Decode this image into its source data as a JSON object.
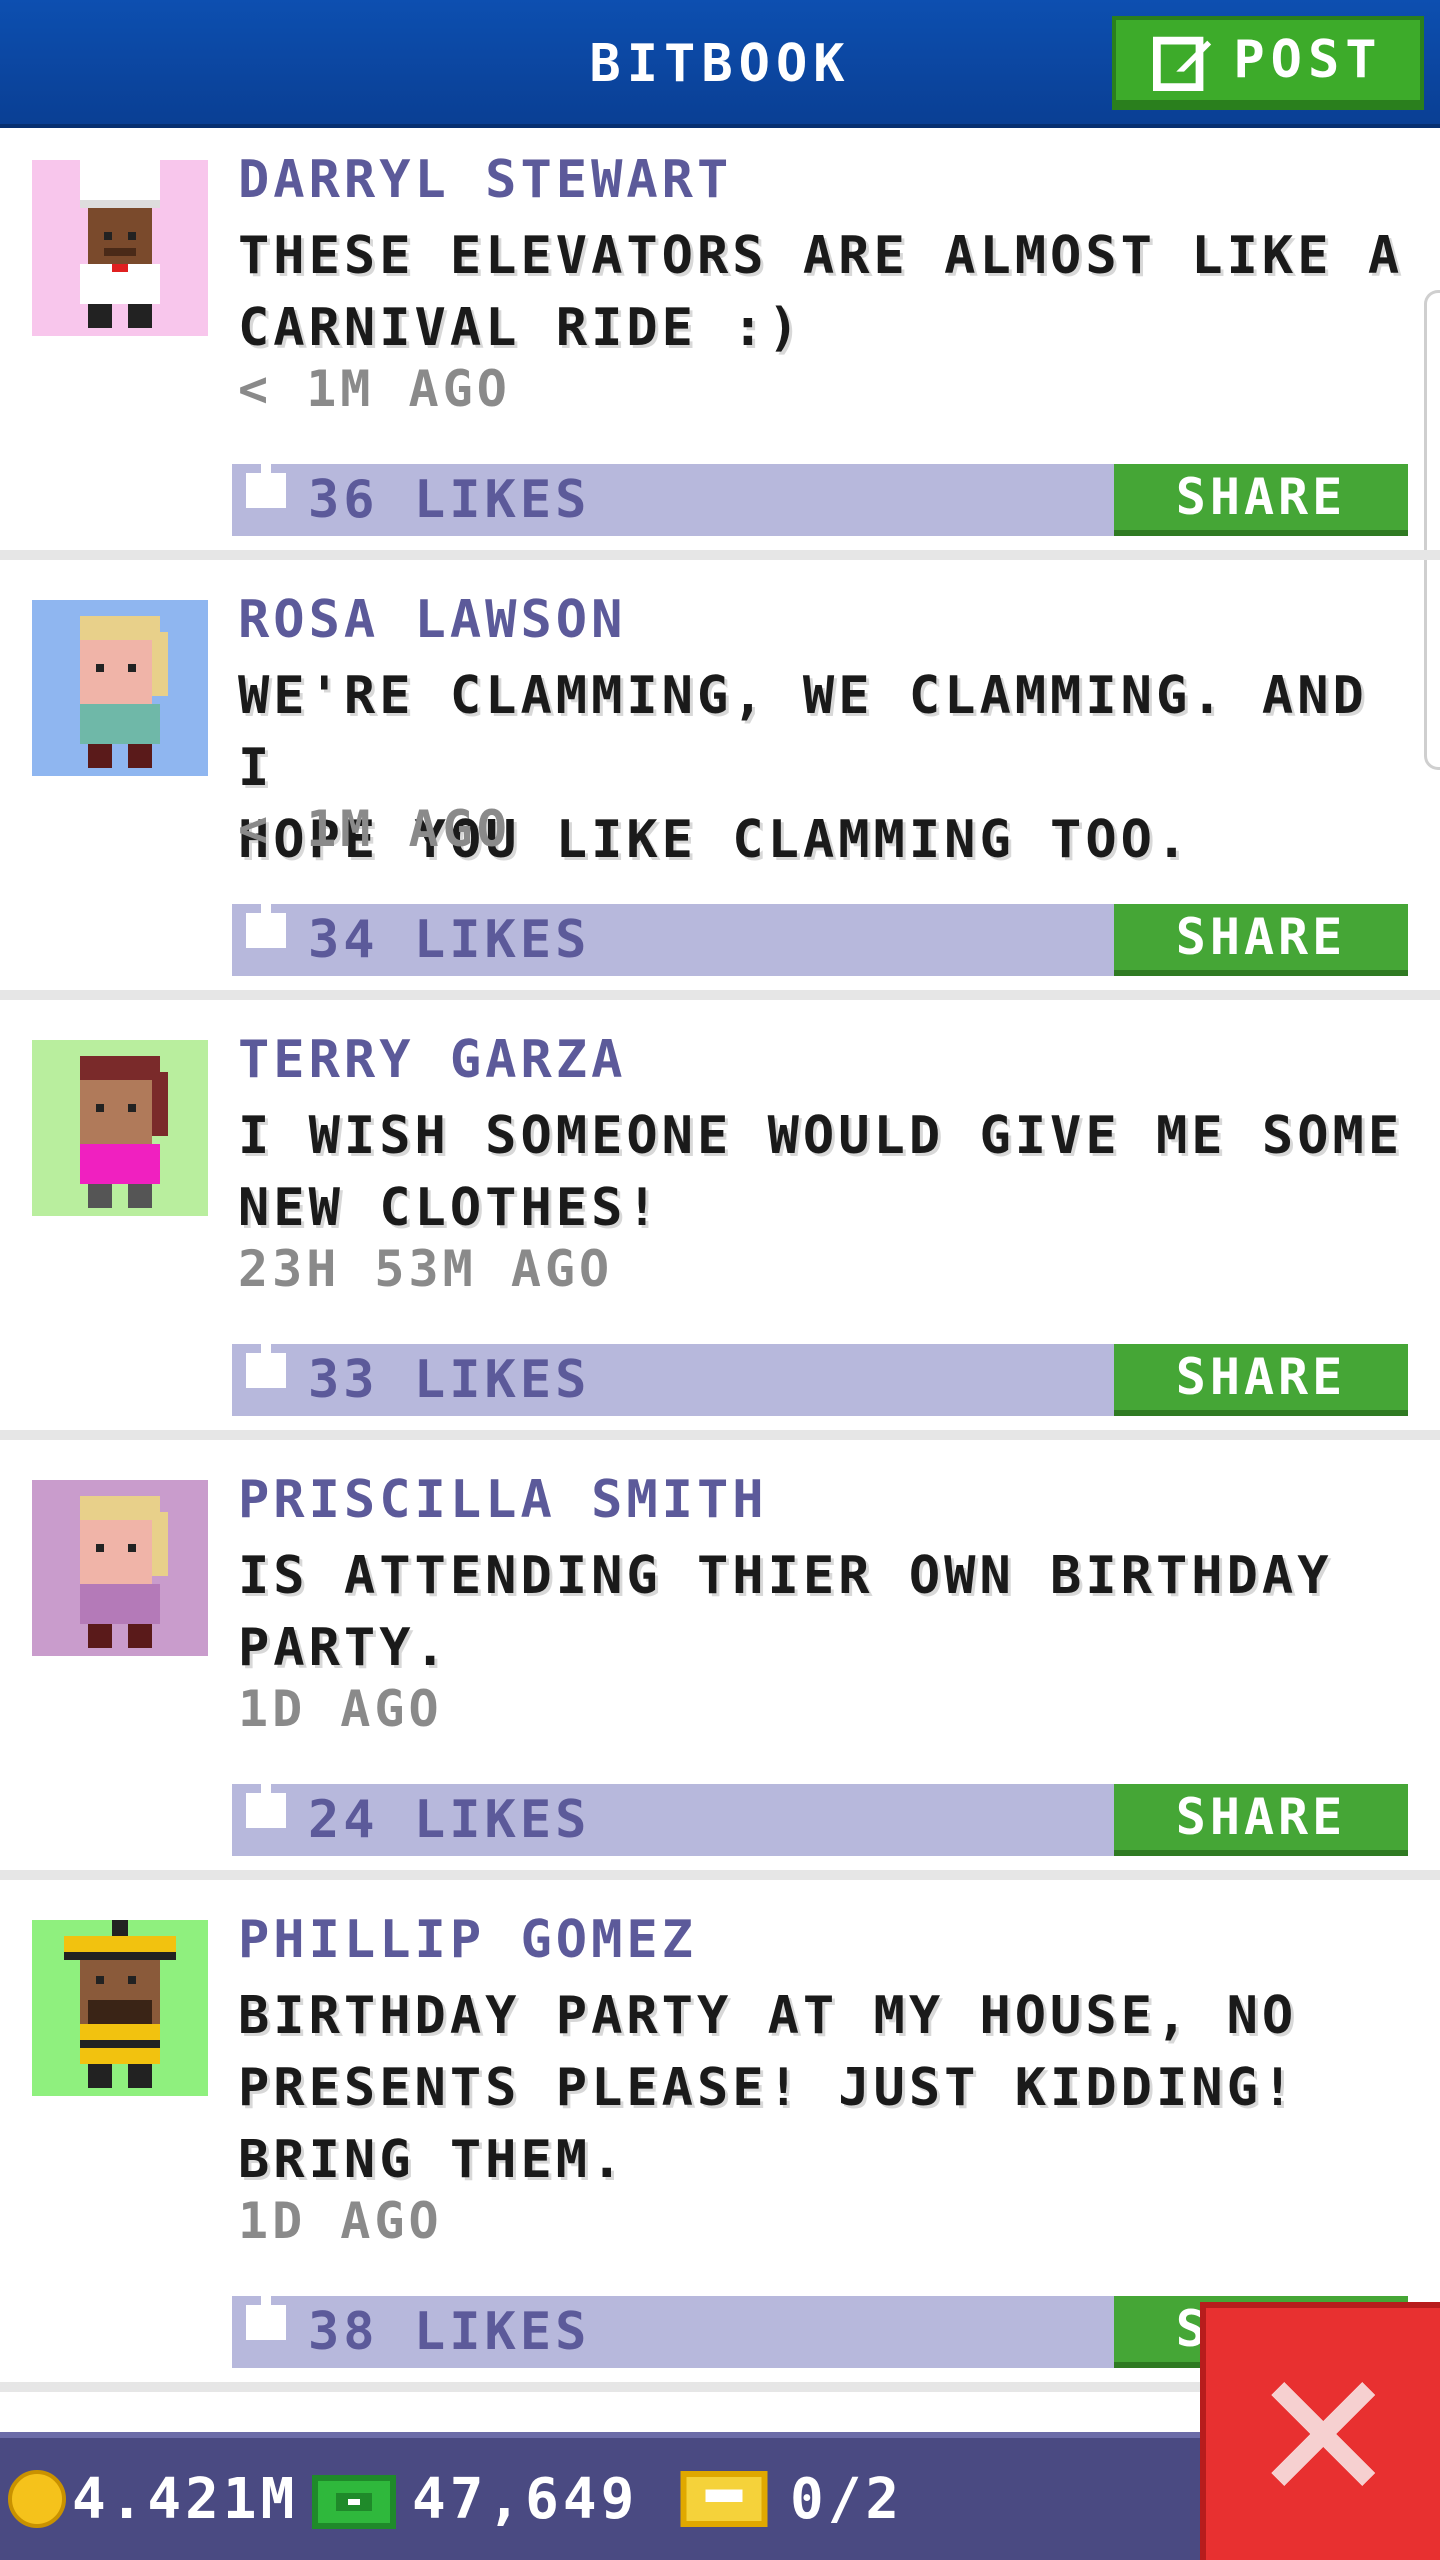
{
  "header": {
    "title": "BITBOOK",
    "post_label": "POST",
    "post_icon": "edit-icon"
  },
  "posts": [
    {
      "author": "DARRYL STEWART",
      "message": "THESE ELEVATORS ARE ALMOST LIKE A\nCARNIVAL RIDE :)",
      "time": "< 1M AGO",
      "likes": "36 LIKES",
      "share": "SHARE",
      "avatar_bg": "#f8c6ec"
    },
    {
      "author": "ROSA LAWSON",
      "message": "WE'RE CLAMMING, WE CLAMMING. AND I\nHOPE YOU LIKE CLAMMING TOO.",
      "time": "< 1M AGO",
      "likes": "34 LIKES",
      "share": "SHARE",
      "avatar_bg": "#8fb6f0"
    },
    {
      "author": "TERRY GARZA",
      "message": "I WISH SOMEONE WOULD GIVE ME SOME\nNEW CLOTHES!",
      "time": "23H 53M AGO",
      "likes": "33 LIKES",
      "share": "SHARE",
      "avatar_bg": "#b9ee9e"
    },
    {
      "author": "PRISCILLA SMITH",
      "message": "IS ATTENDING THIER OWN BIRTHDAY\nPARTY.",
      "time": "1D AGO",
      "likes": "24 LIKES",
      "share": "SHARE",
      "avatar_bg": "#c99ccc"
    },
    {
      "author": "PHILLIP GOMEZ",
      "message": "BIRTHDAY PARTY AT MY HOUSE, NO\nPRESENTS PLEASE! JUST KIDDING!\nBRING THEM.",
      "time": "1D AGO",
      "likes": "38 LIKES",
      "share": "SHARE",
      "avatar_bg": "#8ff07e"
    }
  ],
  "status": {
    "coins": "4.421M",
    "bux": "47,649",
    "tickets": "0/2"
  },
  "colors": {
    "header": "#0d4fb0",
    "accent_green": "#3dab2a",
    "likes_bar": "#b7b8dc",
    "close_red": "#e83030"
  }
}
